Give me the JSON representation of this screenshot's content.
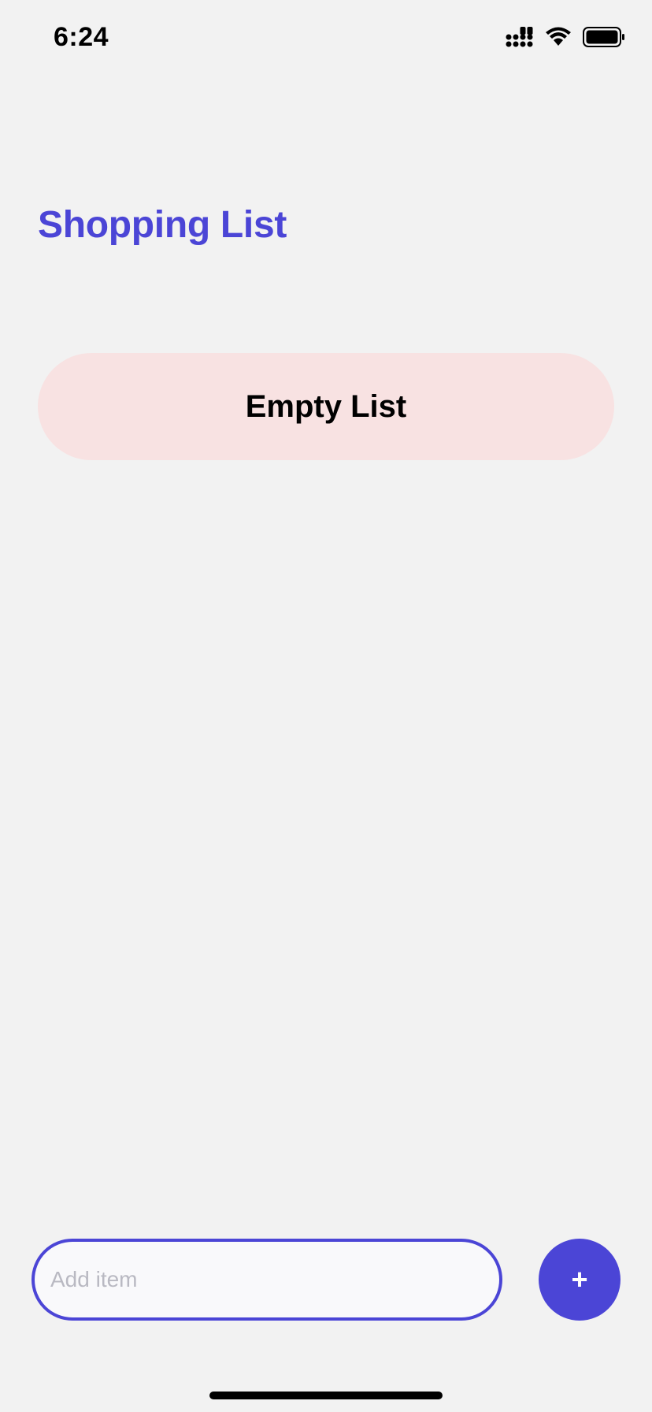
{
  "status_bar": {
    "time": "6:24",
    "icons": [
      "cellular-signal-icon",
      "wifi-icon",
      "battery-icon"
    ]
  },
  "header": {
    "title": "Shopping List"
  },
  "list": {
    "empty_label": "Empty List"
  },
  "composer": {
    "placeholder": "Add item",
    "value": "",
    "add_label": "+"
  },
  "colors": {
    "accent": "#4b45d6",
    "background": "#f2f2f2",
    "empty_card": "#f8e2e2",
    "input_background": "#f9f9fb"
  }
}
